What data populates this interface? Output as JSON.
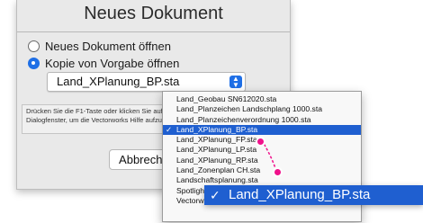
{
  "dialog": {
    "title": "Neues Dokument",
    "option_new": "Neues Dokument öffnen",
    "option_template": "Kopie von Vorgabe öffnen",
    "template_value": "Land_XPlanung_BP.sta",
    "help_text": "Drücken Sie die F1-Taste oder klicken Sie auf das Fragezeichen rechts im Dialogfenster, um die Vectorworks Hilfe aufzurufen.",
    "cancel_label": "Abbrechen"
  },
  "menu": {
    "items": [
      "Land_Geobau SN612020.sta",
      "Land_Planzeichen Landschplang 1000.sta",
      "Land_Planzeichenverordnung 1000.sta",
      "Land_XPlanung_BP.sta",
      "Land_XPlanung_FP.sta",
      "Land_XPlanung_LP.sta",
      "Land_XPlanung_RP.sta",
      "Land_Zonenplan CH.sta",
      "Landschaftsplanung.sta",
      "Spotlight.sta",
      "Vectorworks Vorgabe.sta"
    ],
    "selected_index": 3,
    "checkmark": "✓"
  },
  "zoom_label": "Land_XPlanung_BP.sta",
  "colors": {
    "accent": "#1f5fd0",
    "pointer": "#f0118b"
  }
}
